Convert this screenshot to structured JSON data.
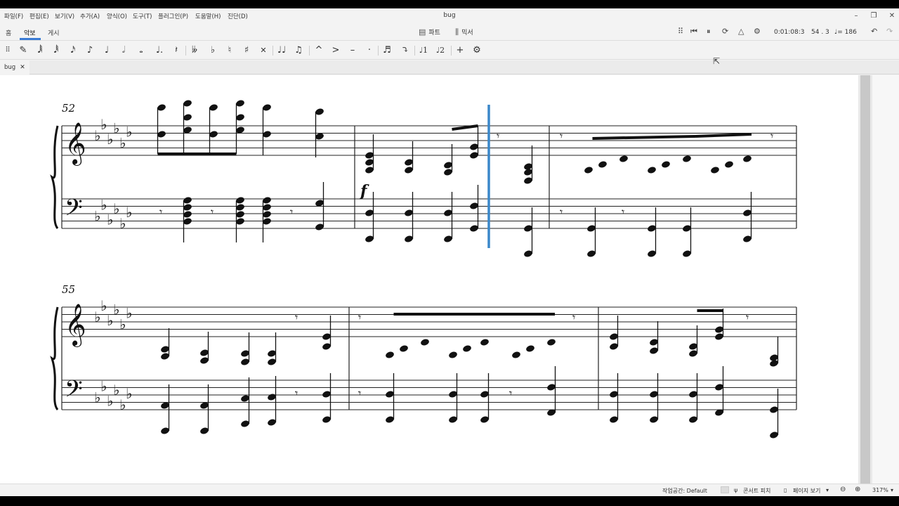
{
  "window": {
    "title": "bug"
  },
  "menu": [
    "파일(F)",
    "편집(E)",
    "보기(V)",
    "추가(A)",
    "양식(O)",
    "도구(T)",
    "플러그인(P)",
    "도움말(H)",
    "진단(D)"
  ],
  "nav_tabs": [
    "홈",
    "악보",
    "게시"
  ],
  "toolbar": {
    "parts": "파트",
    "mixer": "믹서"
  },
  "playback": {
    "time": "0:01:08:3",
    "measure": "54 . 3",
    "tempo": "♩= 186"
  },
  "document": {
    "tab_name": "bug"
  },
  "score": {
    "systems": [
      {
        "first_measure": "52",
        "dynamic": "f"
      },
      {
        "first_measure": "55"
      }
    ],
    "key_signature_flats": 6
  },
  "status": {
    "workspace": "작업공간: Default",
    "concert_pitch": "콘서트 피치",
    "view_mode": "페이지 보기",
    "zoom": "317%"
  },
  "colors": {
    "playback_cursor": "#3a87c9",
    "accent": "#3a7bd5"
  }
}
